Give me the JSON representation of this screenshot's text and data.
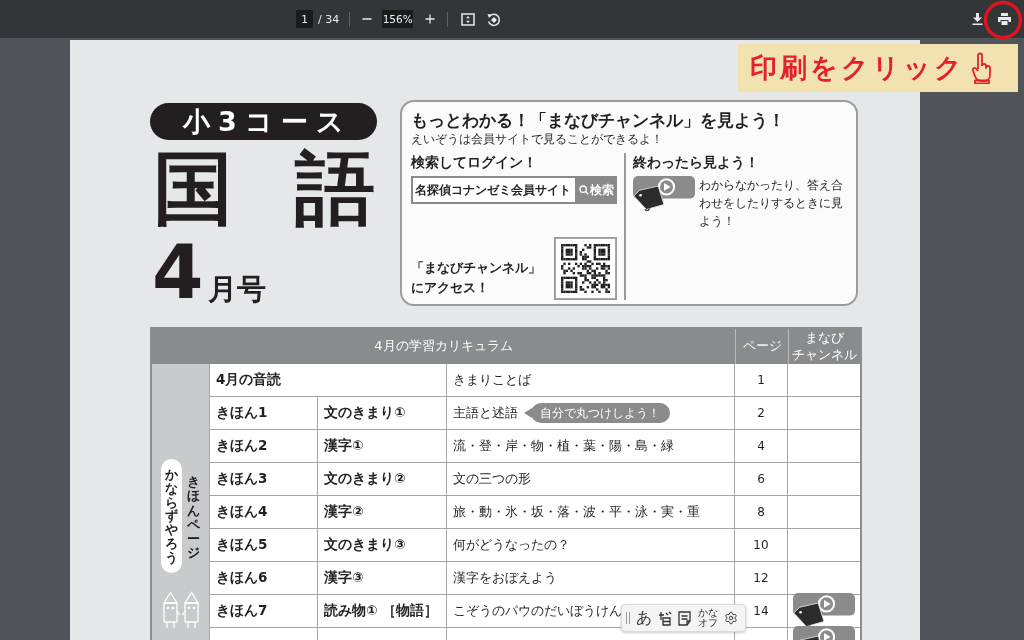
{
  "toolbar": {
    "page_number": "1",
    "page_count": "/ 34",
    "zoom": "156%"
  },
  "annotation": {
    "label": "印刷をクリック"
  },
  "cover": {
    "course": "小3コース",
    "subject": "国語",
    "issue_number": "4",
    "issue_suffix": "月号"
  },
  "channel_box": {
    "title": "もっとわかる！「まなびチャンネル」を見よう！",
    "subtitle": "えいぞうは会員サイトで見ることができるよ！",
    "search_heading": "検索してログイン！",
    "search_value": "名探偵コナンゼミ会員サイト",
    "search_button": "検索",
    "access_text": "「まなびチャンネル」にアクセス！",
    "watch_heading": "終わったら見よう！",
    "watch_text": "わからなかったり、答え合わせをしたりするときに見よう！"
  },
  "table": {
    "title": "4月の学習カリキュラム",
    "columns": [
      {
        "lines": [
          "ページ"
        ]
      },
      {
        "lines": [
          "まなび",
          "チャンネル"
        ]
      }
    ],
    "side_label": "きほんページ",
    "side_tag": "かならずやろう",
    "rows": [
      {
        "kind": "merged",
        "unit": "4月の音読",
        "content": "きまりことば",
        "page": "1",
        "channel": false
      },
      {
        "kind": "split",
        "unit": "きほん1",
        "topic": "文のきまり①",
        "content": "主語と述語",
        "note": "自分で丸つけしよう！",
        "page": "2",
        "channel": false
      },
      {
        "kind": "split",
        "unit": "きほん2",
        "topic": "漢字①",
        "content": "流・登・岸・物・植・葉・陽・島・緑",
        "page": "4",
        "channel": false
      },
      {
        "kind": "split",
        "unit": "きほん3",
        "topic": "文のきまり②",
        "content": "文の三つの形",
        "page": "6",
        "channel": false
      },
      {
        "kind": "split",
        "unit": "きほん4",
        "topic": "漢字②",
        "content": "旅・動・氷・坂・落・波・平・泳・実・重",
        "page": "8",
        "channel": false
      },
      {
        "kind": "split",
        "unit": "きほん5",
        "topic": "文のきまり③",
        "content": "何がどうなったの？",
        "page": "10",
        "channel": false
      },
      {
        "kind": "split",
        "unit": "きほん6",
        "topic": "漢字③",
        "content": "漢字をおぼえよう",
        "page": "12",
        "channel": false
      },
      {
        "kind": "split",
        "unit": "きほん7",
        "topic": "読み物① ［物語］",
        "content": "こぞうのパウのだいぼうけん",
        "page": "14",
        "channel": true
      },
      {
        "kind": "split",
        "channel": true
      }
    ]
  },
  "reader_toolbar": {
    "char_button": "あ",
    "kana_toggle": "かなオフ"
  }
}
